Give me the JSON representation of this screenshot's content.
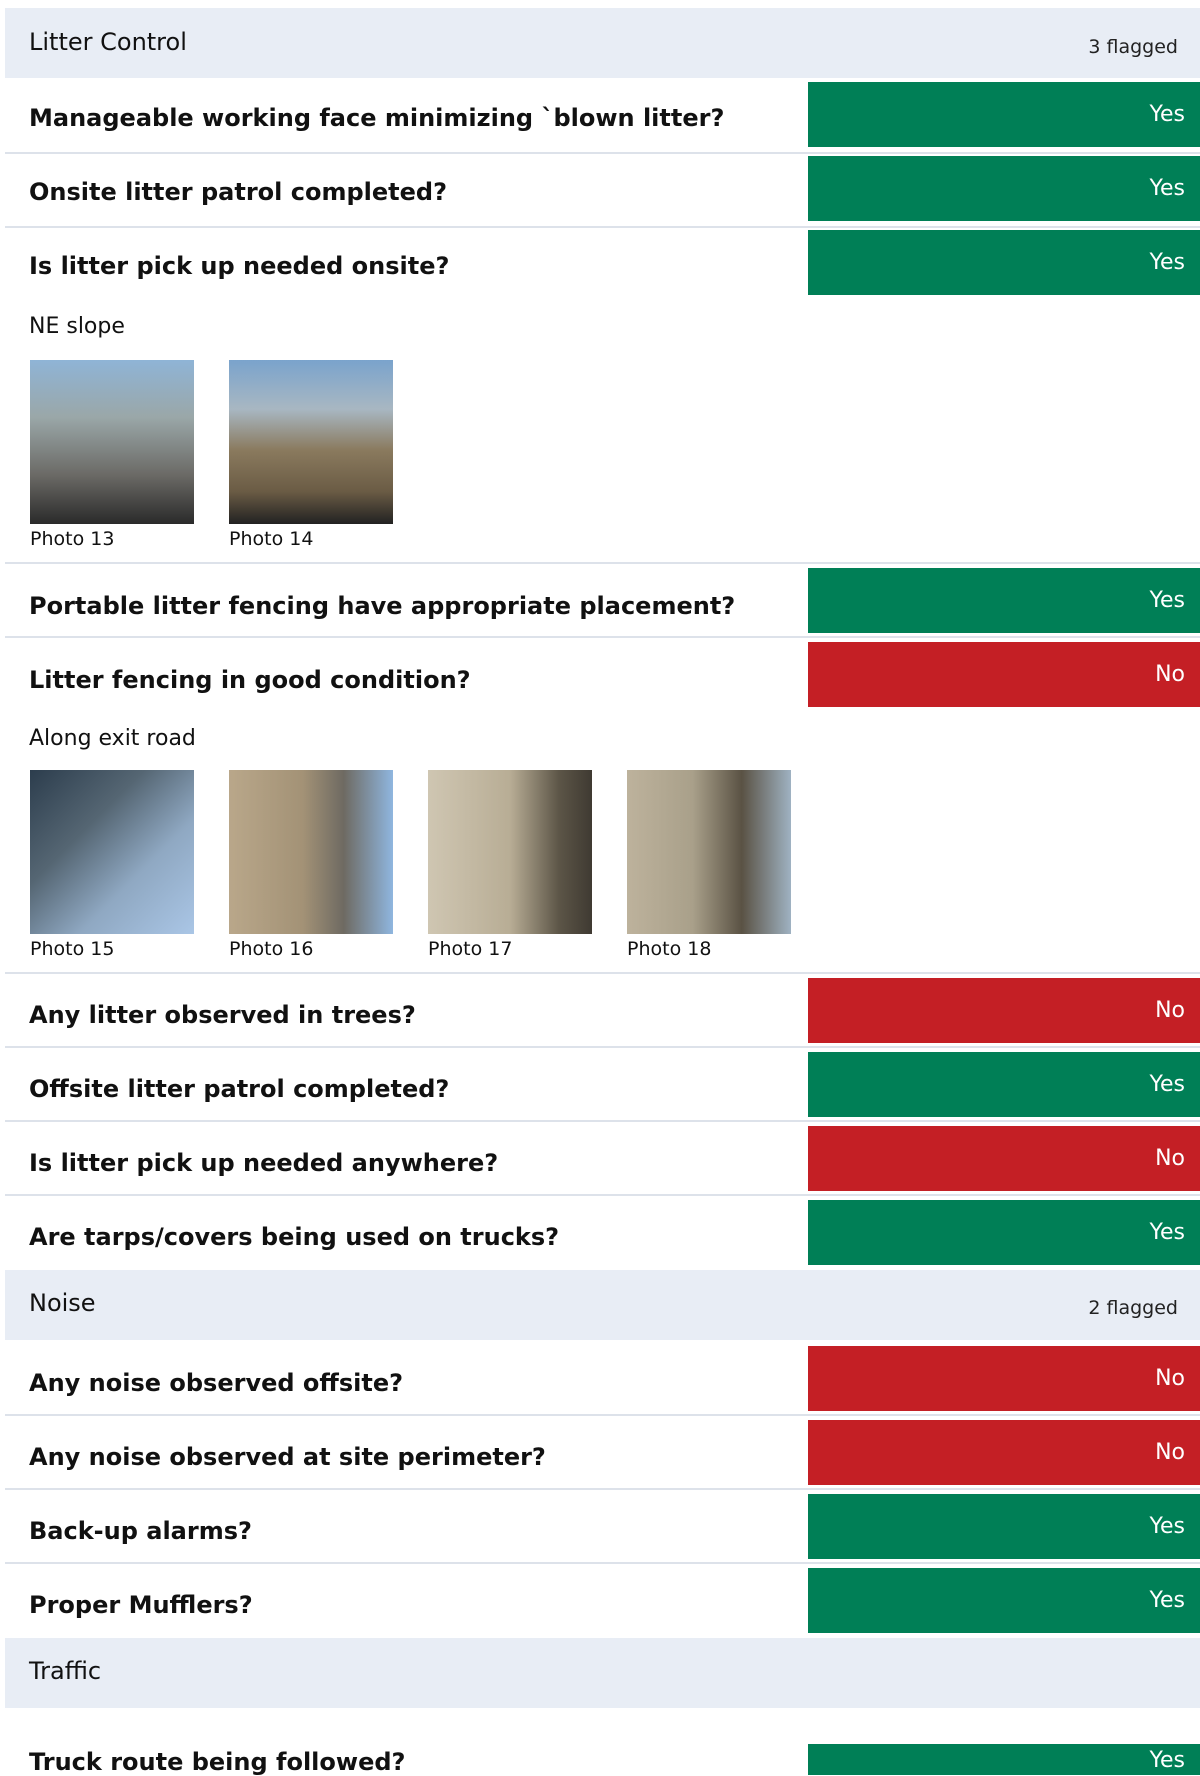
{
  "sections": [
    {
      "title": "Litter Control",
      "flagged": "3 flagged",
      "questions": [
        {
          "text": "Manageable working face minimizing `blown litter?",
          "answer": "Yes"
        },
        {
          "text": "Onsite litter patrol completed?",
          "answer": "Yes"
        },
        {
          "text": "Is litter pick up needed onsite?",
          "answer": "Yes",
          "note": "NE slope",
          "photos": [
            {
              "caption": "Photo 13"
            },
            {
              "caption": "Photo 14"
            }
          ]
        },
        {
          "text": "Portable litter fencing have appropriate placement?",
          "answer": "Yes"
        },
        {
          "text": "Litter fencing in good condition?",
          "answer": "No",
          "note": "Along exit road",
          "photos": [
            {
              "caption": "Photo 15"
            },
            {
              "caption": "Photo 16"
            },
            {
              "caption": "Photo 17"
            },
            {
              "caption": "Photo 18"
            }
          ]
        },
        {
          "text": "Any litter observed in trees?",
          "answer": "No"
        },
        {
          "text": "Offsite litter patrol completed?",
          "answer": "Yes"
        },
        {
          "text": "Is litter pick up needed anywhere?",
          "answer": "No"
        },
        {
          "text": "Are tarps/covers being used on trucks?",
          "answer": "Yes"
        }
      ]
    },
    {
      "title": "Noise",
      "flagged": "2 flagged",
      "questions": [
        {
          "text": "Any noise observed offsite?",
          "answer": "No"
        },
        {
          "text": "Any noise observed at site perimeter?",
          "answer": "No"
        },
        {
          "text": "Back-up alarms?",
          "answer": "Yes"
        },
        {
          "text": "Proper Mufflers?",
          "answer": "Yes"
        }
      ]
    },
    {
      "title": "Traffic",
      "flagged": "",
      "questions": [
        {
          "text": "Truck route being followed?",
          "answer": "Yes"
        }
      ]
    }
  ],
  "colors": {
    "yes": "#007f56",
    "no": "#c41f25",
    "header_bg": "#e8edf5"
  }
}
